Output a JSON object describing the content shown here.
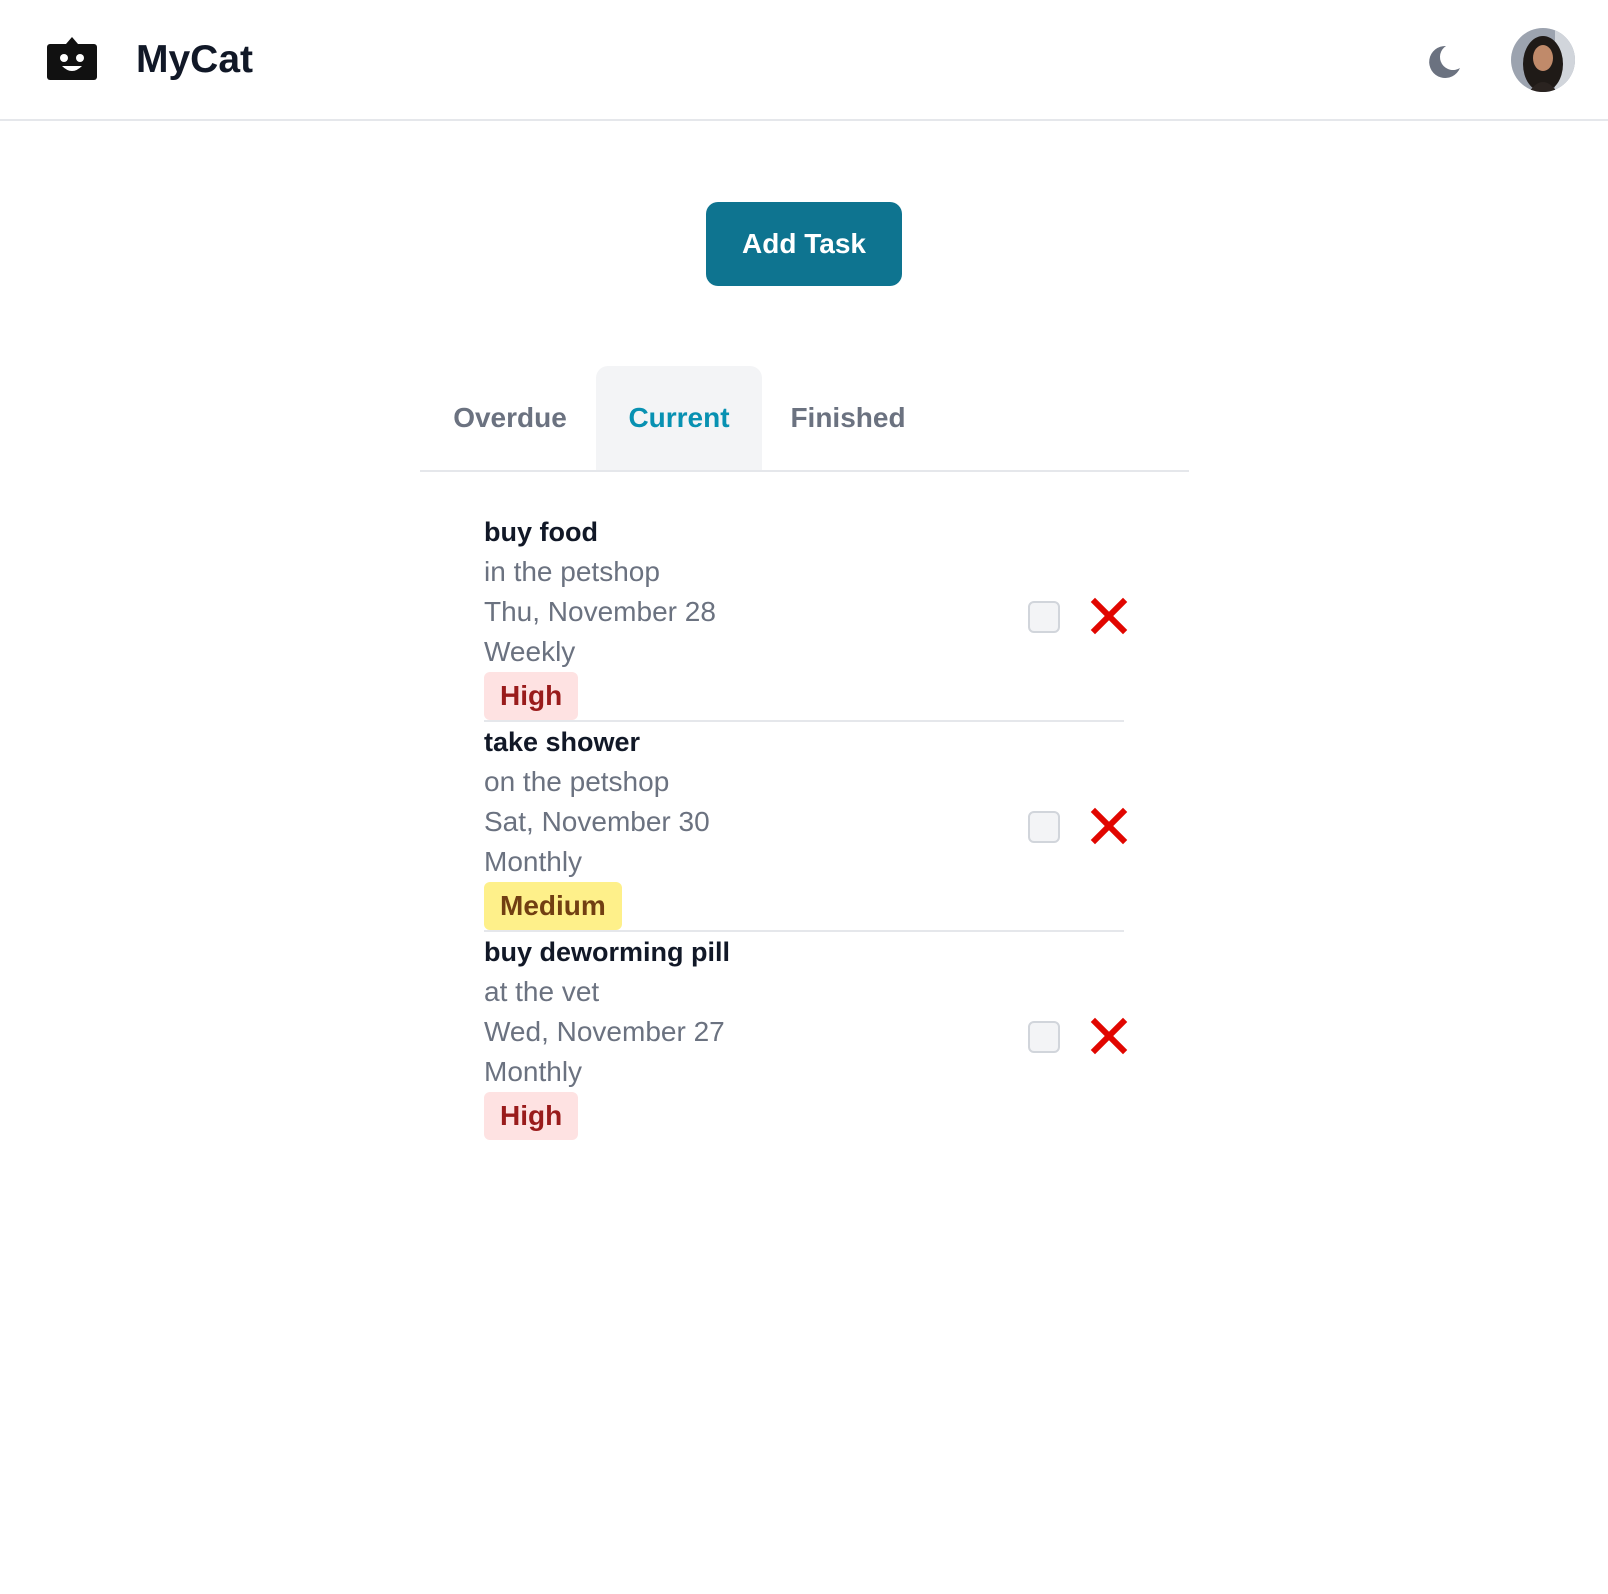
{
  "app": {
    "title": "MyCat"
  },
  "header": {
    "logo_icon": "robot-face-icon",
    "theme_icon": "moon-icon",
    "avatar_icon": "user-avatar"
  },
  "actions": {
    "add_task_label": "Add Task"
  },
  "tabs": [
    {
      "label": "Overdue",
      "active": false
    },
    {
      "label": "Current",
      "active": true
    },
    {
      "label": "Finished",
      "active": false
    }
  ],
  "tasks": [
    {
      "title": "buy food",
      "description": "in the petshop",
      "date": "Thu, November 28",
      "frequency": "Weekly",
      "priority": "High",
      "completed": false
    },
    {
      "title": "take shower",
      "description": "on the petshop",
      "date": "Sat, November 30",
      "frequency": "Monthly",
      "priority": "Medium",
      "completed": false
    },
    {
      "title": "buy deworming pill",
      "description": "at the vet",
      "date": "Wed, November 27",
      "frequency": "Monthly",
      "priority": "High",
      "completed": false
    }
  ],
  "colors": {
    "primary": "#0e7490",
    "active_tab_text": "#0891b2",
    "high_bg": "#fee2e2",
    "high_text": "#991b1b",
    "medium_bg": "#fef08a",
    "medium_text": "#713f12",
    "delete": "#e10600"
  }
}
